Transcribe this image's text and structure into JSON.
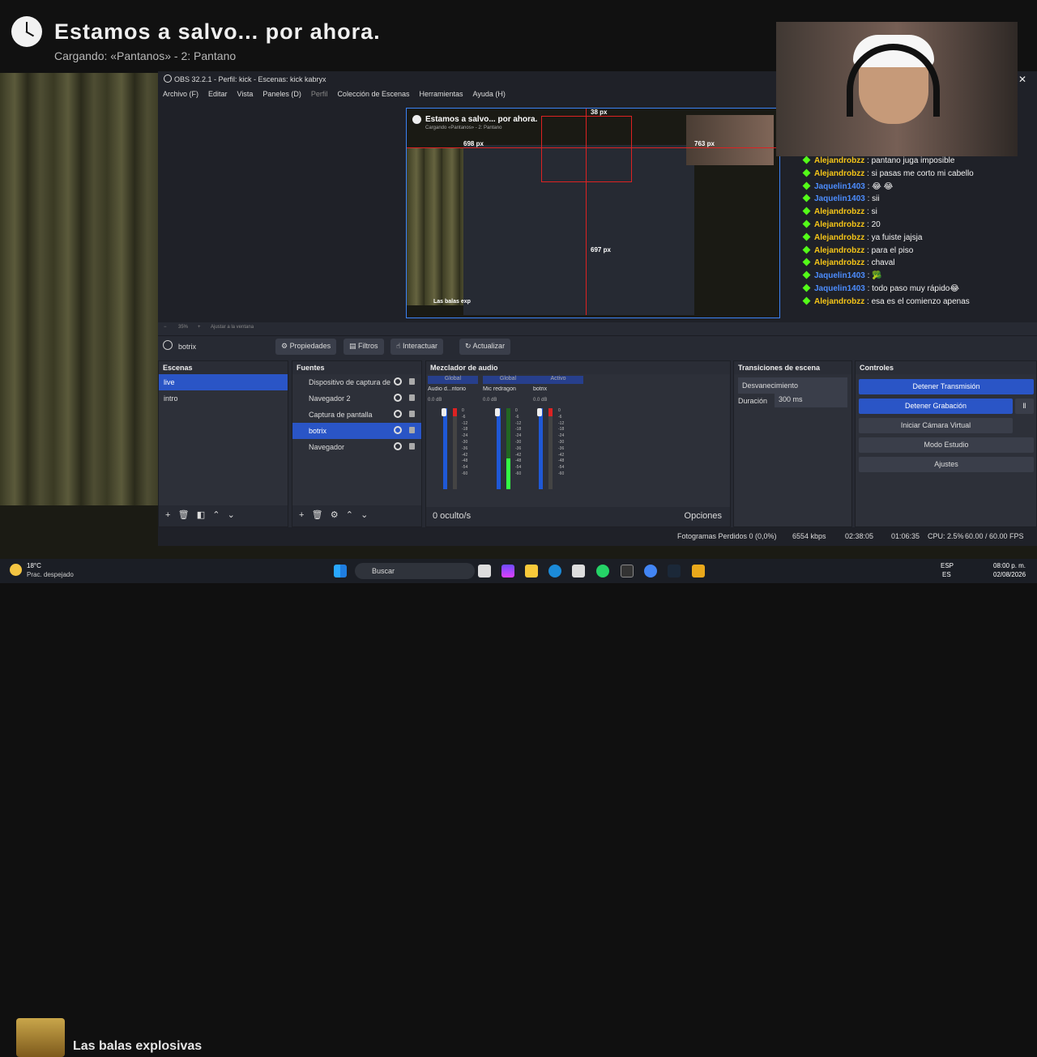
{
  "overlay": {
    "title": "Estamos a salvo... por ahora.",
    "subtitle": "Cargando: «Pantanos» - 2: Pantano",
    "bottom_text": "Las balas explosivas"
  },
  "obs": {
    "window_title": "OBS 32.2.1 - Perfil: kick - Escenas: kick kabryx",
    "menu": [
      "Archivo (F)",
      "Editar",
      "Vista",
      "Paneles (D)",
      "Perfil",
      "Colección de Escenas",
      "Herramientas",
      "Ayuda (H)"
    ],
    "preview": {
      "title": "Estamos a salvo... por ahora.",
      "subtitle": "Cargando «Pantanos» - 2: Pantano",
      "bottom": "Las balas exp",
      "zoom": "35%",
      "fit": "Ajustar a la ventana",
      "measures": [
        "38 px",
        "698 px",
        "763 px",
        "697 px"
      ]
    },
    "selected_source": "botrix",
    "toolbar": {
      "properties": "Propiedades",
      "filters": "Filtros",
      "interact": "Interactuar",
      "refresh": "Actualizar"
    },
    "scenes": {
      "title": "Escenas",
      "items": [
        "live",
        "intro"
      ]
    },
    "sources": {
      "title": "Fuentes",
      "items": [
        "Dispositivo de captura de",
        "Navegador 2",
        "Captura de pantalla",
        "botrix",
        "Navegador"
      ]
    },
    "mixer": {
      "title": "Mezclador de audio",
      "channels": [
        {
          "header": "Global",
          "name": "Audio d...ritorio",
          "db": "0.0 dB"
        },
        {
          "header": "Global",
          "name": "Mic redragon",
          "db": "0.0 dB"
        },
        {
          "header": "Activo",
          "name": "botrix",
          "db": "0.0 dB"
        }
      ],
      "scale": [
        "0",
        "-6",
        "-12",
        "-18",
        "-24",
        "-30",
        "-36",
        "-42",
        "-48",
        "-54",
        "-60"
      ],
      "hidden": "0 oculto/s",
      "options": "Opciones"
    },
    "transitions": {
      "title": "Transiciones de escena",
      "type": "Desvanecimiento",
      "duration_label": "Duración",
      "duration": "300 ms"
    },
    "controls": {
      "title": "Controles",
      "items": [
        "Detener Transmisión",
        "Detener Grabación",
        "Iniciar Cámara Virtual",
        "Modo Estudio",
        "Ajustes"
      ]
    },
    "status": {
      "dropped": "Fotogramas Perdidos 0 (0,0%)",
      "bitrate": "6554 kbps",
      "stream_time": "02:38:05",
      "record_time": "01:06:35",
      "cpu": "CPU: 2.5%",
      "fps": "60.00 / 60.00 FPS"
    }
  },
  "chat": [
    {
      "user": "Alejandrobzz",
      "text": ": pantano juga imposible"
    },
    {
      "user": "Alejandrobzz",
      "text": ": si pasas me corto mi cabello"
    },
    {
      "user": "Jaquelin1403",
      "text": ": 😂 😂"
    },
    {
      "user": "Jaquelin1403",
      "text": ": sii"
    },
    {
      "user": "Alejandrobzz",
      "text": ": si"
    },
    {
      "user": "Alejandrobzz",
      "text": ": 20"
    },
    {
      "user": "Alejandrobzz",
      "text": ": ya fuiste jajsja"
    },
    {
      "user": "Alejandrobzz",
      "text": ": para el piso"
    },
    {
      "user": "Alejandrobzz",
      "text": ": chaval"
    },
    {
      "user": "Jaquelin1403",
      "text": ": 🥦"
    },
    {
      "user": "Jaquelin1403",
      "text": ": todo paso muy rápido😂"
    },
    {
      "user": "Alejandrobzz",
      "text": ": esa es el comienzo apenas"
    }
  ],
  "taskbar": {
    "temp": "18°C",
    "weather": "Prac. despejado",
    "search": "Buscar",
    "lang": "ESP",
    "region": "ES",
    "time": "08:00 p. m.",
    "date": "02/08/2026"
  },
  "colors": {
    "accent": "#2a55c6",
    "kick": "#53fc18",
    "alejandro": "#f5c518",
    "jaquelin": "#4c8dff"
  }
}
